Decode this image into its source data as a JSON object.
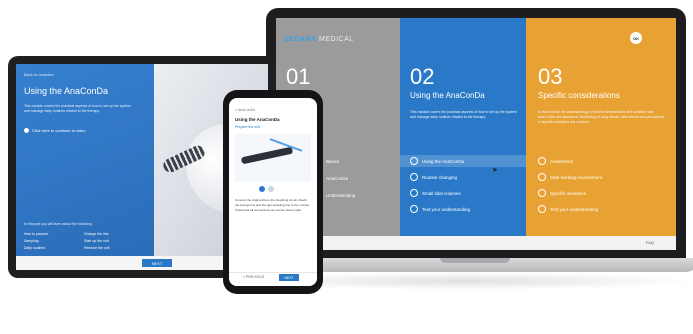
{
  "laptop": {
    "brand": {
      "part1": "SEDANA",
      "part2": "MEDICAL"
    },
    "close_label": "OK",
    "columns": [
      {
        "number": "01",
        "title": "",
        "description": "",
        "items": [
          "Basics",
          "AnaConDa",
          "Understanding"
        ]
      },
      {
        "number": "02",
        "title": "Using the AnaConDa",
        "description": "This module covers the practical aspects of how to set up the system and manage daily routines related to the therapy.",
        "items": [
          "Using the AnaConDa",
          "Routine changing",
          "Small tidal volumes",
          "Test your understanding"
        ]
      },
      {
        "number": "03",
        "title": "Specific considerations",
        "description": "In this module the pharmacology of inhaled anaesthetics and sedation with AnaConDa are discussed. Monitoring of drug effects, side effects and precautions in specific situations are covered.",
        "items": [
          "Anesthetics",
          "Safe working environment",
          "Specific situations",
          "Test your understanding"
        ]
      }
    ],
    "footer_link": "FAQ"
  },
  "tablet": {
    "back_label": "Back to modules",
    "title": "Using the AnaConDa",
    "description": "This module covers the practical aspects of how to set up the system and manage daily routines related to the therapy.",
    "option_label": "Click here to continue to video",
    "topics_intro": "In this part you will learn about the following",
    "topics": [
      "How to prepare",
      "Change the line",
      "Sampling",
      "Start up the unit",
      "Daily routines",
      "Remove the unit"
    ],
    "next_label": "NEXT"
  },
  "phone": {
    "back_label": "< AnaConDa",
    "title": "Using the AnaConDa",
    "subtitle": "Prepare the unit",
    "text": "Connect the AnaConDa to the breathing circuit. Attach the syringe line and the gas sampling line to the monitor. Check that all connections are secure before start.",
    "prev_label": "< PREVIOUS",
    "next_label": "NEXT"
  }
}
